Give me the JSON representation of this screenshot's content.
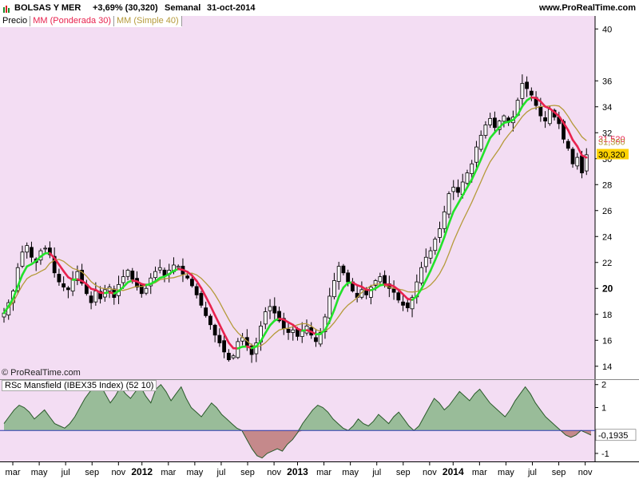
{
  "header": {
    "instrument": "BOLSAS Y MER",
    "change": "+3,69% (30,320)",
    "period": "Semanal",
    "date": "31-oct-2014",
    "site": "www.ProRealTime.com"
  },
  "legend": {
    "price": "Precio",
    "wma": "MM (Ponderada 30)",
    "sma": "MM (Simple 40)"
  },
  "copyright": "© ProRealTime.com",
  "colors": {
    "plot_bg": "#f3ddf3",
    "wma_up": "#22e22a",
    "wma_down": "#e8224e",
    "sma": "#b59a3a",
    "rsc_fill_pos": "#8fb88f",
    "rsc_fill_neg": "#c08080",
    "rsc_line": "#2a5a2a",
    "zero_line": "#2b3bb0"
  },
  "chart_data": [
    {
      "type": "candlestick",
      "title": "",
      "ylim": [
        13,
        41
      ],
      "yticks": [
        14,
        16,
        18,
        20,
        22,
        24,
        26,
        28,
        30,
        32,
        34,
        36,
        40
      ],
      "last_labels": [
        {
          "value": 31.52,
          "text": "31,520",
          "color": "#e8224e"
        },
        {
          "value": 31.3,
          "text": "31,300",
          "color": "#b59a3a"
        },
        {
          "value": 30.32,
          "text": "30,320",
          "color": "#000000",
          "bg": "#ffd200"
        }
      ],
      "close_weekly": [
        18.1,
        18.9,
        19.8,
        21.6,
        22.8,
        23.3,
        22.4,
        22.0,
        22.9,
        23.1,
        22.6,
        21.2,
        20.5,
        20.1,
        19.9,
        20.7,
        21.3,
        20.4,
        19.6,
        18.9,
        19.8,
        19.2,
        19.9,
        20.1,
        19.3,
        20.3,
        20.9,
        21.4,
        20.7,
        20.1,
        19.6,
        20.0,
        20.8,
        21.3,
        21.6,
        21.0,
        21.4,
        21.8,
        21.7,
        21.1,
        20.8,
        20.2,
        19.5,
        18.7,
        17.9,
        17.2,
        16.4,
        15.8,
        15.1,
        14.5,
        14.8,
        15.9,
        16.2,
        15.6,
        14.9,
        15.8,
        17.1,
        18.2,
        18.6,
        18.1,
        17.5,
        16.9,
        16.6,
        16.8,
        16.3,
        16.7,
        17.1,
        16.4,
        15.9,
        16.6,
        17.8,
        19.4,
        20.6,
        21.7,
        21.2,
        20.5,
        19.8,
        19.3,
        19.9,
        19.5,
        20.1,
        20.6,
        20.9,
        20.3,
        20.0,
        19.7,
        19.1,
        18.7,
        18.5,
        19.3,
        20.5,
        21.6,
        22.4,
        22.9,
        23.8,
        24.6,
        25.9,
        27.3,
        27.8,
        27.4,
        28.2,
        28.9,
        29.6,
        30.9,
        31.8,
        32.6,
        33.1,
        32.4,
        32.9,
        33.3,
        32.8,
        33.2,
        34.5,
        35.8,
        35.4,
        34.9,
        34.1,
        33.3,
        32.9,
        33.8,
        33.2,
        32.7,
        31.5,
        30.8,
        29.6,
        30.1,
        28.9,
        30.3
      ]
    },
    {
      "type": "area",
      "title": "RSc Mansfield (IBEX35 Index) (52 10)",
      "ylim": [
        -1.35,
        2.2
      ],
      "yticks": [
        -1,
        1,
        2
      ],
      "last_label": {
        "value": -0.1935,
        "text": "-0,1935"
      },
      "values": [
        0.3,
        0.6,
        0.9,
        1.1,
        1.0,
        0.8,
        0.5,
        0.7,
        0.9,
        0.6,
        0.3,
        0.2,
        0.1,
        0.3,
        0.6,
        1.0,
        1.4,
        1.7,
        1.9,
        2.0,
        1.6,
        1.2,
        1.5,
        1.9,
        1.6,
        1.4,
        1.7,
        1.9,
        1.5,
        1.2,
        1.8,
        2.0,
        1.7,
        1.3,
        1.6,
        1.9,
        1.4,
        1.0,
        0.8,
        0.6,
        0.9,
        1.2,
        1.0,
        0.7,
        0.5,
        0.3,
        0.1,
        0.0,
        -0.4,
        -0.8,
        -1.1,
        -1.2,
        -1.0,
        -0.9,
        -0.8,
        -0.9,
        -0.6,
        -0.4,
        -0.1,
        0.3,
        0.6,
        0.9,
        1.1,
        1.0,
        0.8,
        0.5,
        0.3,
        0.1,
        0.0,
        0.2,
        0.5,
        0.3,
        0.2,
        0.4,
        0.7,
        0.5,
        0.3,
        0.6,
        0.8,
        0.5,
        0.2,
        0.0,
        0.2,
        0.6,
        1.0,
        1.4,
        1.2,
        0.9,
        1.1,
        1.4,
        1.7,
        1.5,
        1.3,
        1.6,
        1.8,
        1.5,
        1.2,
        1.0,
        0.8,
        0.6,
        0.9,
        1.3,
        1.6,
        1.9,
        1.6,
        1.2,
        0.9,
        0.6,
        0.4,
        0.2,
        0.0,
        -0.2,
        -0.3,
        -0.2,
        0.0,
        -0.1,
        -0.2
      ]
    }
  ],
  "x_axis": {
    "labels": [
      {
        "text": "mar",
        "week": 3,
        "bold": false
      },
      {
        "text": "may",
        "week": 12,
        "bold": false
      },
      {
        "text": "jul",
        "week": 21,
        "bold": false
      },
      {
        "text": "sep",
        "week": 30,
        "bold": false
      },
      {
        "text": "nov",
        "week": 39,
        "bold": false
      },
      {
        "text": "2012",
        "week": 47,
        "bold": true
      },
      {
        "text": "mar",
        "week": 56,
        "bold": false
      },
      {
        "text": "may",
        "week": 65,
        "bold": false
      },
      {
        "text": "jul",
        "week": 74,
        "bold": false
      },
      {
        "text": "sep",
        "week": 83,
        "bold": false
      },
      {
        "text": "nov",
        "week": 92,
        "bold": false
      },
      {
        "text": "2013",
        "week": 100,
        "bold": true
      },
      {
        "text": "mar",
        "week": 109,
        "bold": false
      },
      {
        "text": "may",
        "week": 118,
        "bold": false
      },
      {
        "text": "jul",
        "week": 127,
        "bold": false
      },
      {
        "text": "sep",
        "week": 136,
        "bold": false
      },
      {
        "text": "nov",
        "week": 145,
        "bold": false
      },
      {
        "text": "2014",
        "week": 153,
        "bold": true
      },
      {
        "text": "mar",
        "week": 162,
        "bold": false
      },
      {
        "text": "may",
        "week": 171,
        "bold": false
      },
      {
        "text": "jul",
        "week": 180,
        "bold": false
      },
      {
        "text": "sep",
        "week": 189,
        "bold": false
      },
      {
        "text": "nov",
        "week": 198,
        "bold": false
      }
    ],
    "total_weeks": 200
  }
}
